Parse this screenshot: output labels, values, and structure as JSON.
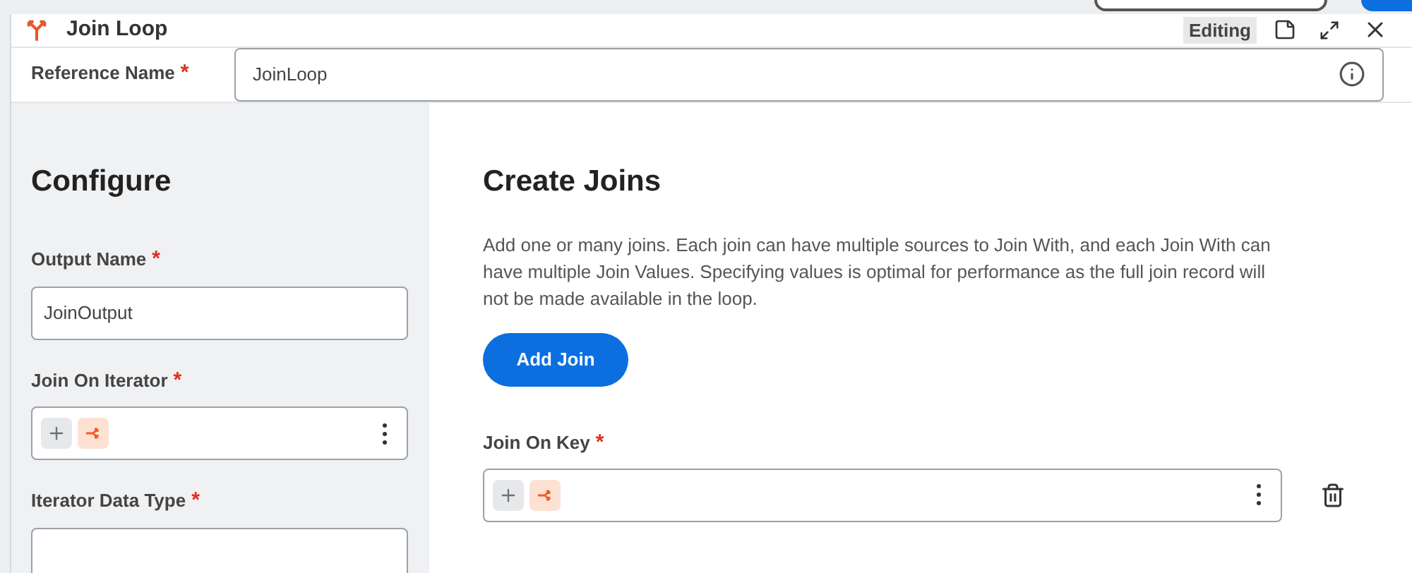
{
  "window": {
    "title": "Join Loop",
    "status": "Editing"
  },
  "reference_name": {
    "label": "Reference Name",
    "required_mark": "*",
    "value": "JoinLoop"
  },
  "configure": {
    "title": "Configure",
    "fields": [
      {
        "kind": "text",
        "label": "Output Name",
        "required_mark": "*",
        "value": "JoinOutput"
      },
      {
        "kind": "pills",
        "label": "Join On Iterator",
        "required_mark": "*"
      },
      {
        "kind": "text",
        "label": "Iterator Data Type",
        "required_mark": "*"
      }
    ]
  },
  "create_joins": {
    "title": "Create Joins",
    "description": "Add one or many joins. Each join can have multiple sources to Join With, and each Join With can have multiple Join Values. Specifying values is optimal for performance as the full join record will not be made available in the loop.",
    "button": "Add Join",
    "join_on_key": {
      "label": "Join On Key",
      "required_mark": "*"
    }
  }
}
